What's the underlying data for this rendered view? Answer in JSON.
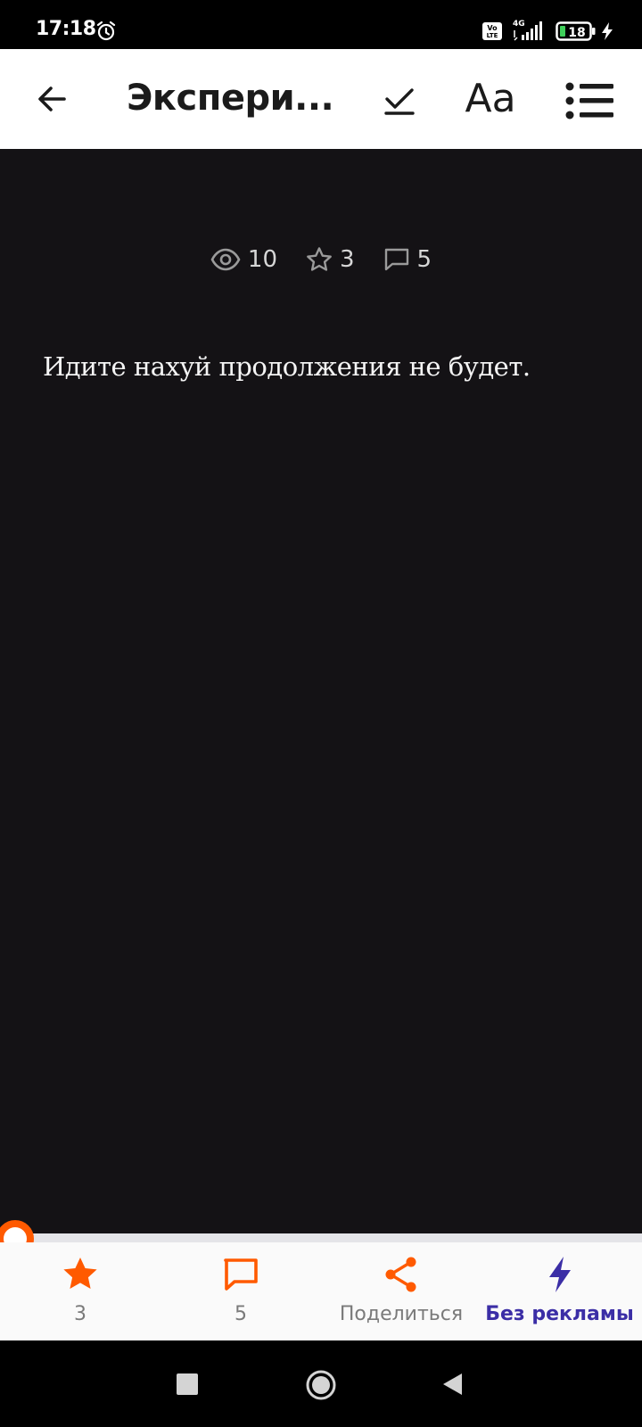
{
  "status_bar": {
    "time": "17:18",
    "network_label": "4G",
    "volte_label": "Vo LTE",
    "battery_level": "18",
    "icons": [
      "alarm-icon",
      "volte-icon",
      "signal-icon",
      "battery-icon",
      "charging-icon"
    ]
  },
  "app_bar": {
    "title": "Экспери...",
    "font_label": "Aa",
    "icons": [
      "back-arrow-icon",
      "check-icon",
      "list-icon"
    ]
  },
  "stats": {
    "views": "10",
    "stars": "3",
    "comments": "5"
  },
  "chapter": {
    "text": "Идите нахуй продолжения не будет."
  },
  "reading_progress": 0,
  "actions": {
    "rate_count": "3",
    "comments_count": "5",
    "share_label": "Поделиться",
    "no_ads_label": "Без рекламы"
  },
  "colors": {
    "accent": "#ff5a00",
    "premium": "#3b2ea6",
    "background": "#141215"
  }
}
